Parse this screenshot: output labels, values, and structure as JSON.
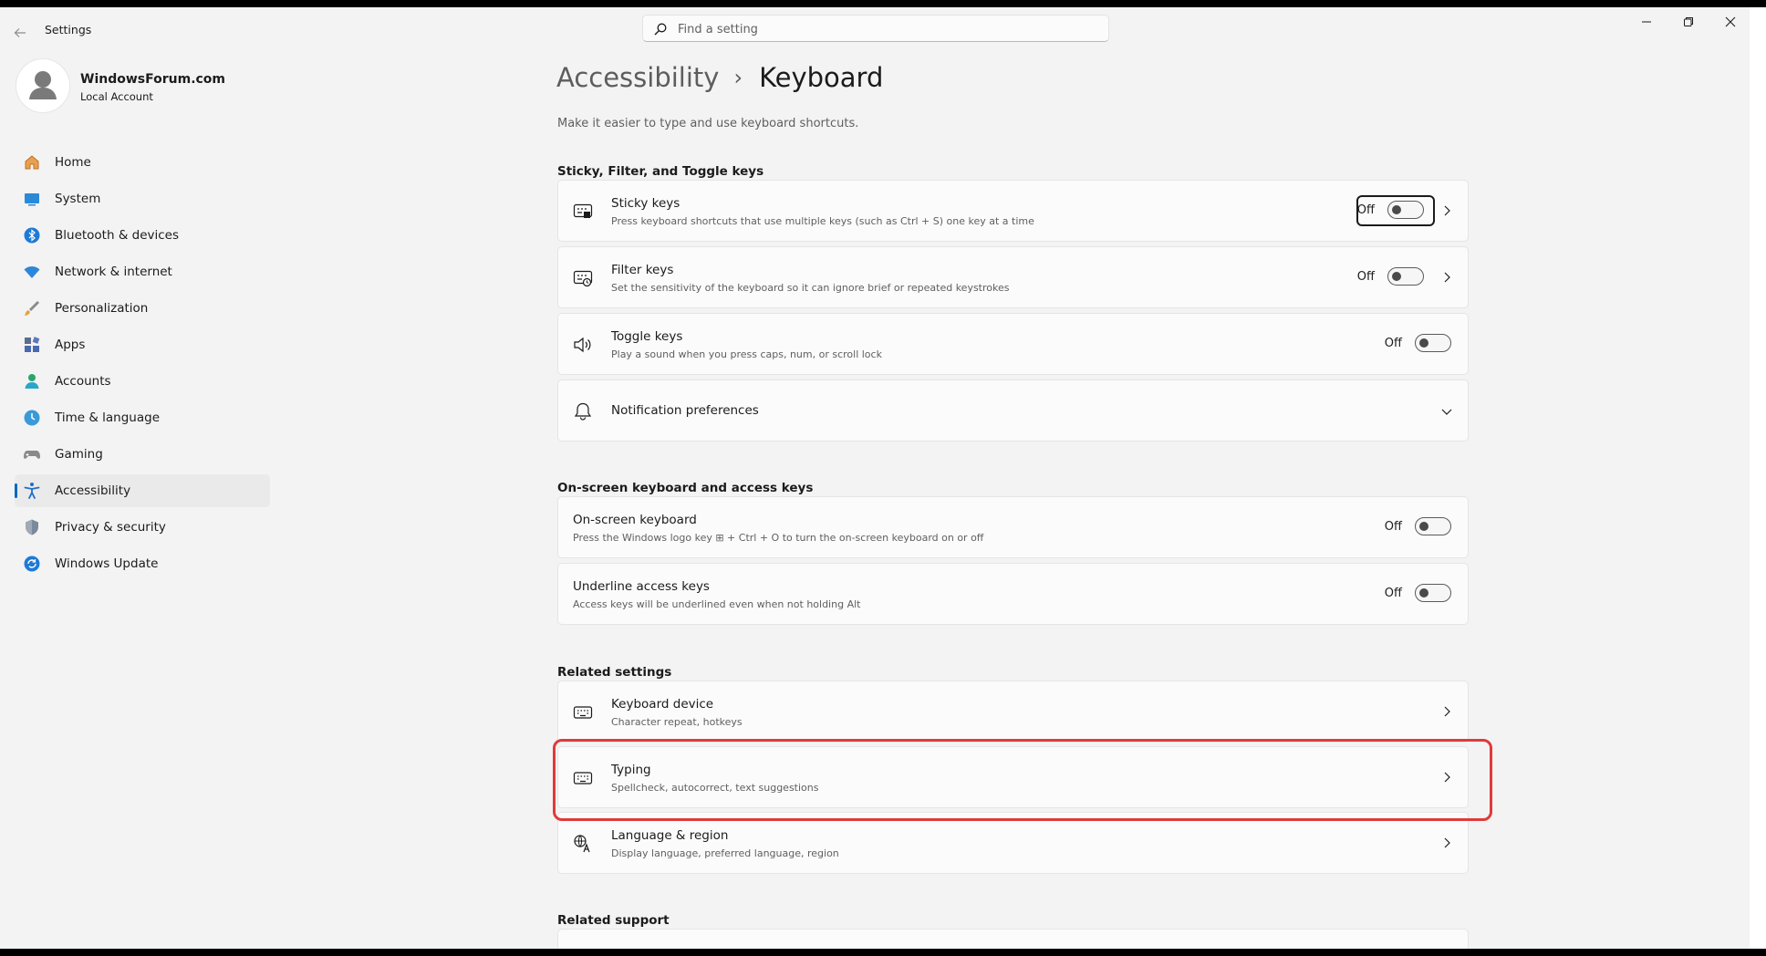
{
  "app": {
    "title": "Settings"
  },
  "search": {
    "placeholder": "Find a setting"
  },
  "account": {
    "name": "WindowsForum.com",
    "type": "Local Account"
  },
  "nav": {
    "items": [
      {
        "label": "Home",
        "icon": "home-icon"
      },
      {
        "label": "System",
        "icon": "system-icon"
      },
      {
        "label": "Bluetooth & devices",
        "icon": "bluetooth-icon"
      },
      {
        "label": "Network & internet",
        "icon": "wifi-icon"
      },
      {
        "label": "Personalization",
        "icon": "brush-icon"
      },
      {
        "label": "Apps",
        "icon": "apps-icon"
      },
      {
        "label": "Accounts",
        "icon": "person-icon"
      },
      {
        "label": "Time & language",
        "icon": "globe-clock-icon"
      },
      {
        "label": "Gaming",
        "icon": "gamepad-icon"
      },
      {
        "label": "Accessibility",
        "icon": "accessibility-icon",
        "selected": true
      },
      {
        "label": "Privacy & security",
        "icon": "shield-icon"
      },
      {
        "label": "Windows Update",
        "icon": "update-icon"
      }
    ]
  },
  "page": {
    "breadcrumb_parent": "Accessibility",
    "breadcrumb_separator": "›",
    "title": "Keyboard",
    "description": "Make it easier to type and use keyboard shortcuts."
  },
  "sections": {
    "sticky": {
      "heading": "Sticky, Filter, and Toggle keys",
      "items": [
        {
          "title": "Sticky keys",
          "sub": "Press keyboard shortcuts that use multiple keys (such as Ctrl + S) one key at a time",
          "toggle": "Off",
          "icon": "sticky-keys-icon"
        },
        {
          "title": "Filter keys",
          "sub": "Set the sensitivity of the keyboard so it can ignore brief or repeated keystrokes",
          "toggle": "Off",
          "icon": "filter-keys-icon"
        },
        {
          "title": "Toggle keys",
          "sub": "Play a sound when you press caps, num, or scroll lock",
          "toggle": "Off",
          "icon": "speaker-icon"
        },
        {
          "title": "Notification preferences",
          "icon": "bell-icon"
        }
      ]
    },
    "onscreen": {
      "heading": "On-screen keyboard and access keys",
      "items": [
        {
          "title": "On-screen keyboard",
          "sub": "Press the Windows logo key ⊞ + Ctrl + O to turn the on-screen keyboard on or off",
          "toggle": "Off"
        },
        {
          "title": "Underline access keys",
          "sub": "Access keys will be underlined even when not holding Alt",
          "toggle": "Off"
        }
      ]
    },
    "related": {
      "heading": "Related settings",
      "items": [
        {
          "title": "Keyboard device",
          "sub": "Character repeat, hotkeys",
          "icon": "keyboard-icon"
        },
        {
          "title": "Typing",
          "sub": "Spellcheck, autocorrect, text suggestions",
          "icon": "keyboard-icon"
        },
        {
          "title": "Language & region",
          "sub": "Display language, preferred language, region",
          "icon": "language-icon"
        }
      ]
    },
    "support": {
      "heading": "Related support"
    }
  },
  "colors": {
    "accent": "#0067c0",
    "highlight": "#e03a3a",
    "background": "#f3f3f3",
    "card": "#fbfbfb"
  }
}
